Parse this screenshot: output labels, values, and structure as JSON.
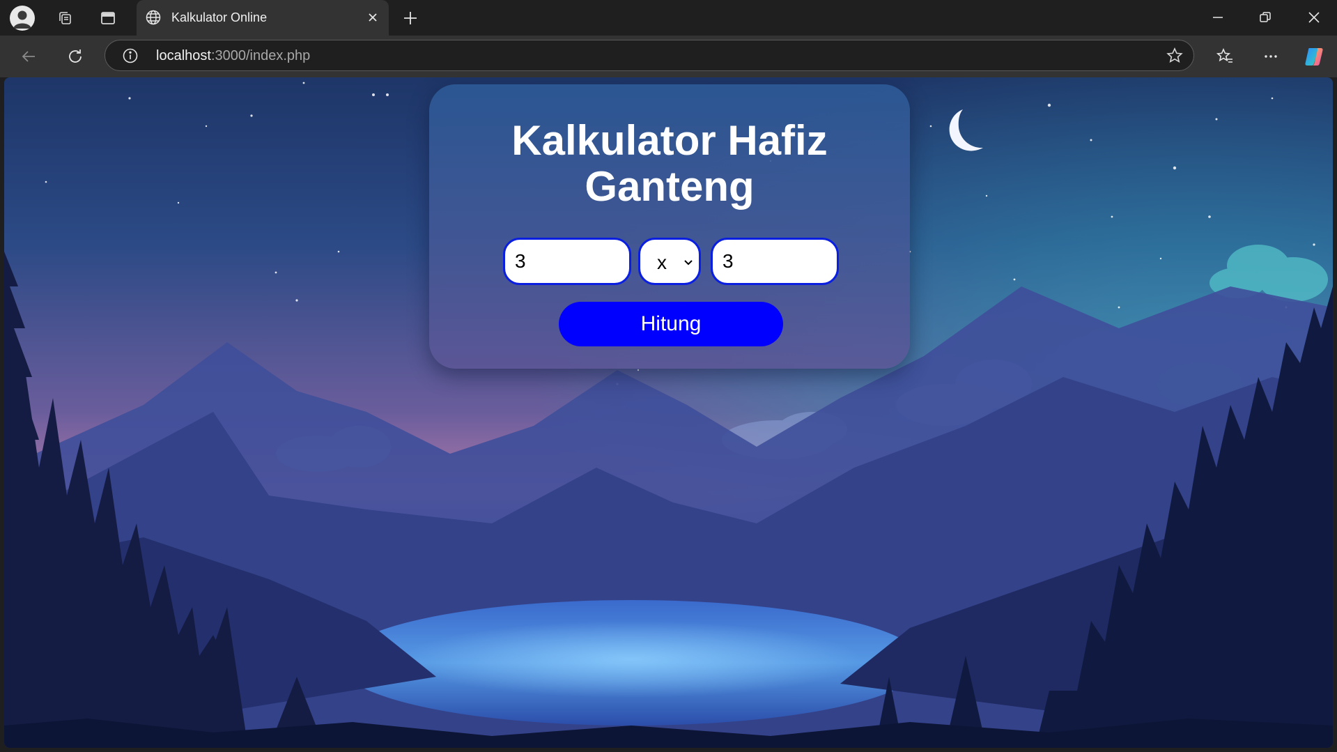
{
  "browser": {
    "tab": {
      "title": "Kalkulator Online"
    },
    "address_bar": {
      "host": "localhost",
      "path": ":3000/index.php"
    }
  },
  "page": {
    "title": "Kalkulator Hafiz Ganteng",
    "inputs": {
      "first_number": "3",
      "second_number": "3"
    },
    "operator": {
      "selected": "x"
    },
    "calculate_label": "Hitung"
  },
  "colors": {
    "accent_blue": "#0000ff",
    "input_border": "#0a1fe0",
    "browser_chrome": "#1f1f1f",
    "toolbar": "#333333"
  },
  "icons": {
    "profile": "profile-icon",
    "workspaces": "workspaces-icon",
    "vertical_tabs": "tab-actions-icon",
    "tab_favicon": "globe-icon",
    "close_tab": "close-icon",
    "new_tab": "plus-icon",
    "back": "back-arrow-icon",
    "refresh": "refresh-icon",
    "site_info": "info-icon",
    "favorite": "star-icon",
    "favorites": "favorites-icon",
    "more": "more-icon",
    "copilot": "copilot-icon"
  }
}
